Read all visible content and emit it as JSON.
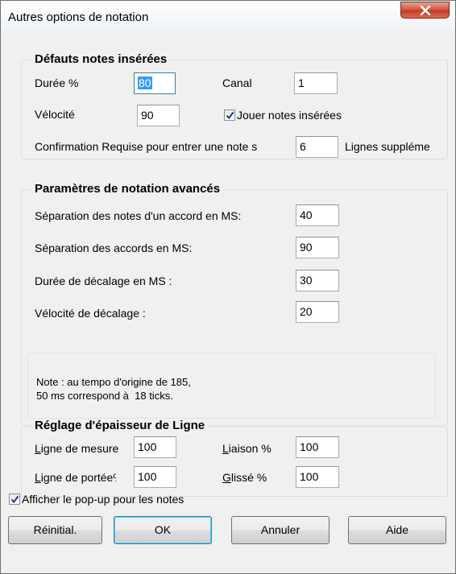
{
  "window": {
    "title": "Autres options de notation"
  },
  "inserted_defaults": {
    "group_title": "Défauts notes insérées",
    "duration_label": "Durée %",
    "duration_value": "80",
    "channel_label": "Canal",
    "channel_value": "1",
    "velocity_label": "Vélocité",
    "velocity_value": "90",
    "play_inserted_label": "Jouer notes insérées",
    "play_inserted_checked": true,
    "confirmation_label": "Confirmation Requise pour entrer une note s",
    "confirmation_value": "6",
    "extra_lines_label": "Lignes suppléme"
  },
  "advanced": {
    "group_title": "Paramètres de notation avancés",
    "chord_note_sep_label": "Séparation des notes d'un accord en MS:",
    "chord_note_sep_value": "40",
    "chord_sep_label": "Séparation des accords en MS:",
    "chord_sep_value": "90",
    "offset_duration_label": "Durée de décalage en MS :",
    "offset_duration_value": "30",
    "offset_velocity_label": "Vélocité de décalage :",
    "offset_velocity_value": "20",
    "note_line1": "Note : au tempo d'origine de 185,",
    "note_line2": "50 ms correspond à  18 ticks."
  },
  "thickness": {
    "group_title": "Réglage d'épaisseur de Ligne",
    "bar_line_first": "L",
    "bar_line_rest": "igne de mesure",
    "bar_line_value": "100",
    "staff_line_first": "L",
    "staff_line_rest": "igne de portée",
    "staff_line_cut": "%",
    "staff_line_value": "100",
    "tie_first": "L",
    "tie_rest": "iaison %",
    "tie_value": "100",
    "slide_first": "G",
    "slide_rest": "lissé %",
    "slide_value": "100"
  },
  "popup": {
    "label": "Afficher le pop-up pour les notes",
    "checked": true
  },
  "buttons": {
    "reset": "Réinitial.",
    "ok": "OK",
    "cancel": "Annuler",
    "help": "Aide"
  }
}
